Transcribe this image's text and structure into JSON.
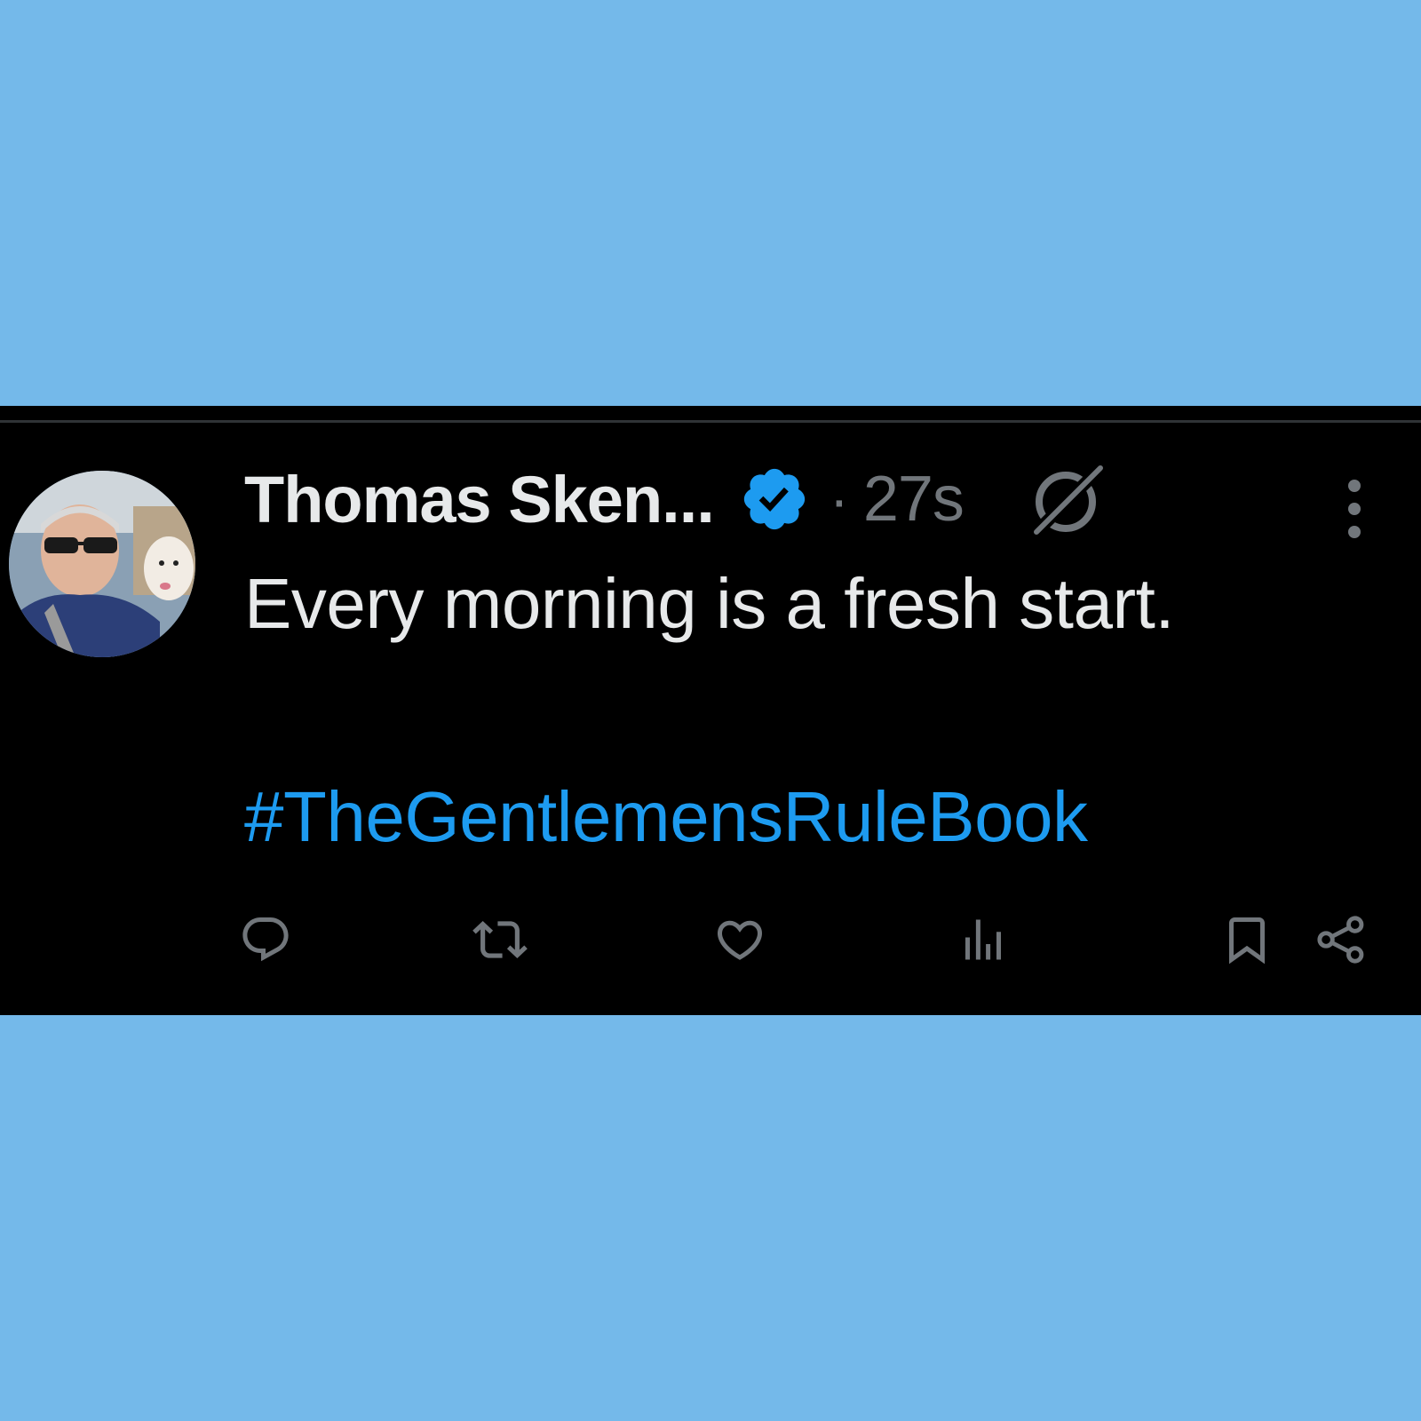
{
  "background_color": "#74b9ea",
  "tweet": {
    "author": {
      "display_name": "Thomas Sken...",
      "verified": true,
      "avatar_icon": "avatar-photo"
    },
    "separator": "·",
    "timestamp": "27s",
    "body": "Every morning is a fresh start.",
    "hashtag": "#TheGentlemensRuleBook",
    "colors": {
      "background": "#000000",
      "text": "#e7e9ea",
      "secondary": "#71767b",
      "accent": "#1d9bf0"
    },
    "header_icons": [
      "verified-badge-icon",
      "grok-icon",
      "more-options-icon"
    ],
    "actions": [
      {
        "name": "reply",
        "icon": "reply-icon"
      },
      {
        "name": "repost",
        "icon": "repost-icon"
      },
      {
        "name": "like",
        "icon": "like-icon"
      },
      {
        "name": "views",
        "icon": "views-icon"
      },
      {
        "name": "bookmark",
        "icon": "bookmark-icon"
      },
      {
        "name": "share",
        "icon": "share-icon"
      }
    ]
  }
}
